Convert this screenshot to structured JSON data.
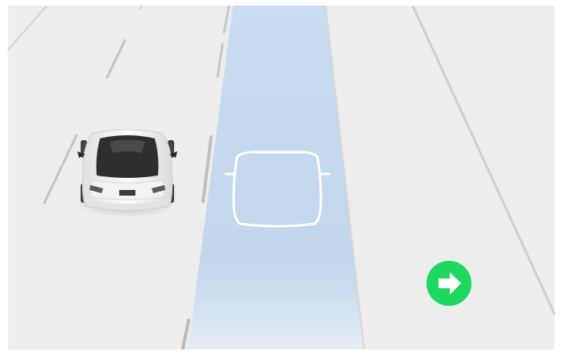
{
  "scene": {
    "type": "autopilot-lane-change-visualization",
    "road_color": "#ededed",
    "page_color": "#ffffff",
    "lane_line_color": "#c9c9c9",
    "target_lane_color": "#c6d9ee",
    "ghost_car_outline_color": "#ffffff",
    "ego_car": {
      "body_color": "#f4f4f4",
      "roof_color": "#2f2f2f",
      "position": "left-lane"
    },
    "target_car_outline": {
      "position": "center-lane",
      "style": "outline"
    }
  },
  "lane_change": {
    "direction": "right",
    "indicator_color": "#1ed760",
    "indicator_arrow_color": "#ffffff",
    "icon": "arrow-right-icon"
  }
}
